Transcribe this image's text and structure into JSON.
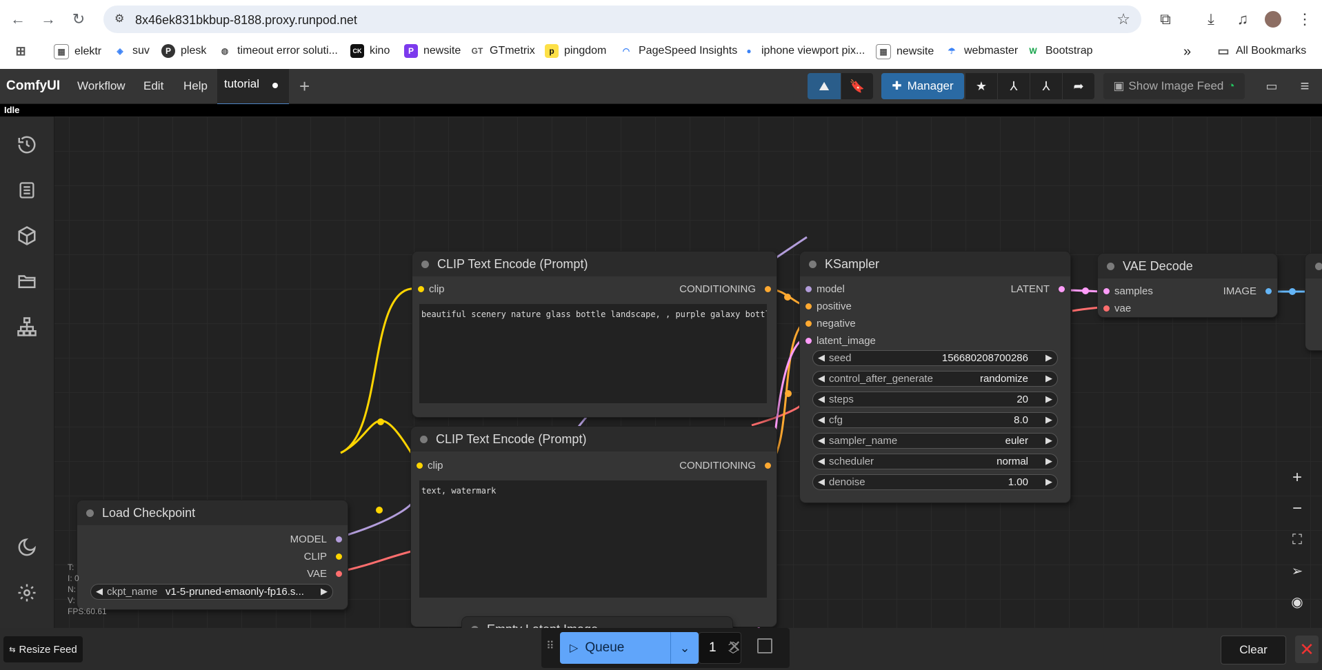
{
  "browser": {
    "url": "8x46ek831bkbup-8188.proxy.runpod.net",
    "bookmarks": [
      "elektr",
      "suv",
      "plesk",
      "timeout error soluti...",
      "kino",
      "newsite",
      "GTmetrix",
      "pingdom",
      "PageSpeed Insights",
      "iphone viewport pix...",
      "newsite",
      "webmaster",
      "Bootstrap"
    ],
    "all_bookmarks": "All Bookmarks",
    "overflow": "»"
  },
  "app": {
    "logo": "ComfyUI",
    "menus": [
      "Workflow",
      "Edit",
      "Help"
    ],
    "tab": "tutorial",
    "manager": "Manager",
    "show_image_feed": "Show Image Feed",
    "status": "Idle"
  },
  "nodes": {
    "clip_pos": {
      "title": "CLIP Text Encode (Prompt)",
      "input": "clip",
      "output": "CONDITIONING",
      "text": "beautiful scenery nature glass bottle landscape, , purple galaxy bottle,"
    },
    "clip_neg": {
      "title": "CLIP Text Encode (Prompt)",
      "input": "clip",
      "output": "CONDITIONING",
      "text": "text, watermark"
    },
    "ksampler": {
      "title": "KSampler",
      "inputs": [
        "model",
        "positive",
        "negative",
        "latent_image"
      ],
      "output": "LATENT",
      "widgets": [
        {
          "label": "seed",
          "value": "156680208700286"
        },
        {
          "label": "control_after_generate",
          "value": "randomize"
        },
        {
          "label": "steps",
          "value": "20"
        },
        {
          "label": "cfg",
          "value": "8.0"
        },
        {
          "label": "sampler_name",
          "value": "euler"
        },
        {
          "label": "scheduler",
          "value": "normal"
        },
        {
          "label": "denoise",
          "value": "1.00"
        }
      ]
    },
    "vae_decode": {
      "title": "VAE Decode",
      "inputs": [
        "samples",
        "vae"
      ],
      "output": "IMAGE"
    },
    "load_ckpt": {
      "title": "Load Checkpoint",
      "outputs": [
        "MODEL",
        "CLIP",
        "VAE"
      ],
      "widget_label": "ckpt_name",
      "widget_value": "v1-5-pruned-emaonly-fp16.s..."
    },
    "empty_latent": {
      "title": "Empty Latent Image"
    }
  },
  "stats": {
    "fps": "FPS:60.61",
    "lines": [
      "T:",
      "I: 0",
      "N:",
      "V:"
    ]
  },
  "bottom": {
    "resize_feed": "Resize Feed",
    "queue": "Queue",
    "batch_count": "1",
    "clear": "Clear"
  },
  "colors": {
    "clip_wire": "#ffd500",
    "model_wire": "#b39ddb",
    "vae_wire": "#ff6e6e",
    "cond_wire": "#ffa931",
    "latent_wire": "#ff9cf9",
    "image_wire": "#64b5f6",
    "accent": "#60a5fa"
  }
}
